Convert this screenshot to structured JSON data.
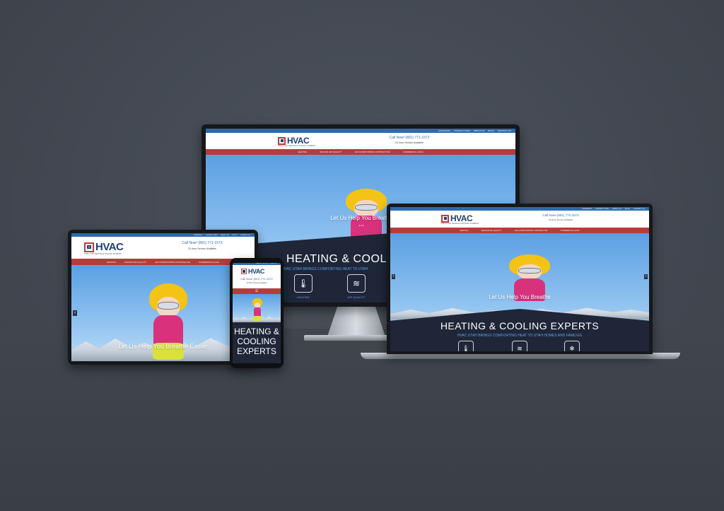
{
  "site": {
    "logo_text": "HVAC",
    "logo_subtext": "HVAC UTAH HEATING & COOLING COMPANY",
    "top_links": [
      "FINANCING",
      "CONTACT HVAC",
      "ABOUT US",
      "BLOG",
      "CONTACT US"
    ],
    "call_text": "Call Now! (801) 771-1572",
    "service_text": "24 Hour Service Available",
    "nav_items": [
      "HEATING",
      "INDOOR AIR QUALITY",
      "AIR CONDITIONING CONTRACTOR",
      "COMMERCIAL HVAC"
    ],
    "tagline": "Let Us Help You Breathe Easier",
    "hero_title": "HEATING & COOLING EXPERTS",
    "hero_subtitle": "HVAC UTAH BRINGS COMFORTING HEAT TO UTAH HOMES AND FAMILIES",
    "monitor_hero_title": "HEATING & COOLING",
    "monitor_hero_subtitle": "HVAC UTAH BRINGS COMFORTING HEAT TO UTAH",
    "monitor_tagline": "Let Us Help You Breathe",
    "laptop_tagline": "Let Us Help You Breathe",
    "tablet_tagline": "Let Us Help You Breathe Easier",
    "phone_hero_lines": [
      "HEATING &",
      "COOLING",
      "EXPERTS"
    ],
    "services": [
      {
        "icon": "thermometer-icon",
        "label": "HEATING"
      },
      {
        "icon": "air-quality-icon",
        "label": "AIR QUALITY"
      }
    ],
    "slider_dots": "● ● ●",
    "arrow_left": "‹",
    "arrow_right": "›"
  },
  "colors": {
    "background": "#434852",
    "topbar_blue": "#2d6bb0",
    "nav_red": "#b63b3b",
    "band_navy": "#1e2638",
    "accent_blue": "#5fa2e6"
  }
}
